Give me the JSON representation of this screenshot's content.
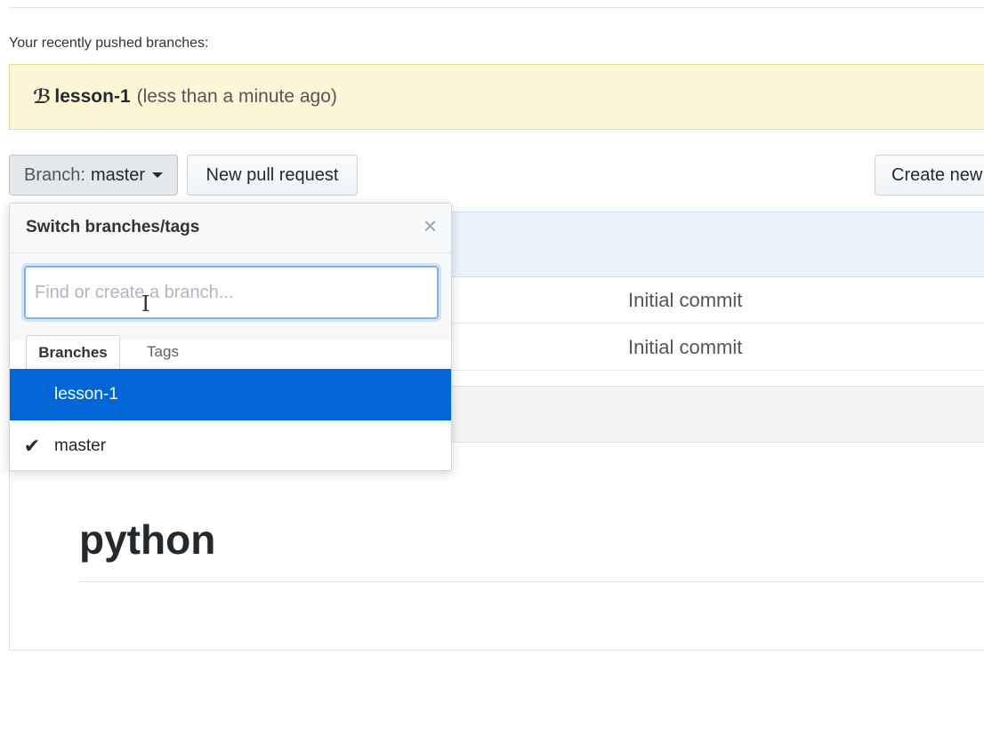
{
  "recent": {
    "label": "Your recently pushed branches:",
    "branch_icon": "git-branch-icon",
    "branch_name": "lesson-1",
    "time": "(less than a minute ago)"
  },
  "toolbar": {
    "branch_prefix": "Branch:",
    "branch_value": "master",
    "new_pr_label": "New pull request",
    "create_label": "Create new"
  },
  "files": {
    "rows": [
      {
        "message": "Initial commit"
      },
      {
        "message": "Initial commit"
      }
    ]
  },
  "readme": {
    "title": "python"
  },
  "dropdown": {
    "title": "Switch branches/tags",
    "close_icon": "close-icon",
    "filter_placeholder": "Find or create a branch...",
    "tabs": [
      {
        "label": "Branches",
        "active": true
      },
      {
        "label": "Tags",
        "active": false
      }
    ],
    "branches": [
      {
        "name": "lesson-1",
        "selected": true,
        "checked": false
      },
      {
        "name": "master",
        "selected": false,
        "checked": true
      }
    ]
  },
  "colors": {
    "accent": "#0366d6",
    "banner_bg": "#fdf6d6"
  }
}
